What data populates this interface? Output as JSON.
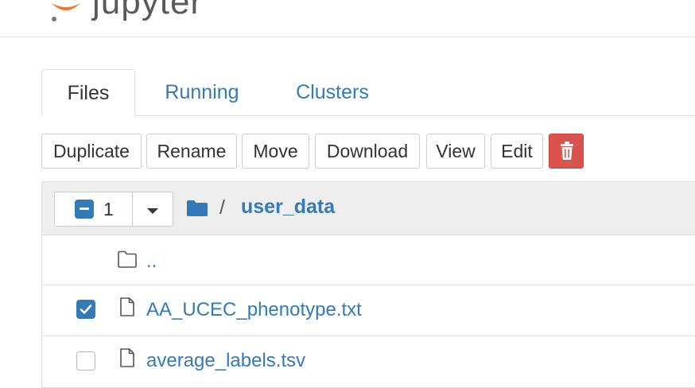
{
  "header": {
    "app_name": "jupyter",
    "logo_color": "#F37726"
  },
  "tabs": [
    {
      "label": "Files",
      "active": true
    },
    {
      "label": "Running",
      "active": false
    },
    {
      "label": "Clusters",
      "active": false
    }
  ],
  "toolbar": {
    "duplicate_label": "Duplicate",
    "rename_label": "Rename",
    "move_label": "Move",
    "download_label": "Download",
    "view_label": "View",
    "edit_label": "Edit",
    "delete_icon": "trash-icon",
    "delete_color": "#D9534F"
  },
  "list_header": {
    "selected_count": "1",
    "breadcrumb_separator": "/",
    "current_folder": "user_data"
  },
  "rows": [
    {
      "type": "folder",
      "name": "..",
      "icon": "folder-outline-icon",
      "checked": null
    },
    {
      "type": "file",
      "name": "AA_UCEC_phenotype.txt",
      "icon": "file-icon",
      "checked": true
    },
    {
      "type": "file",
      "name": "average_labels.tsv",
      "icon": "file-icon",
      "checked": false
    }
  ],
  "colors": {
    "link": "#337AB7",
    "accent": "#337AB7"
  }
}
